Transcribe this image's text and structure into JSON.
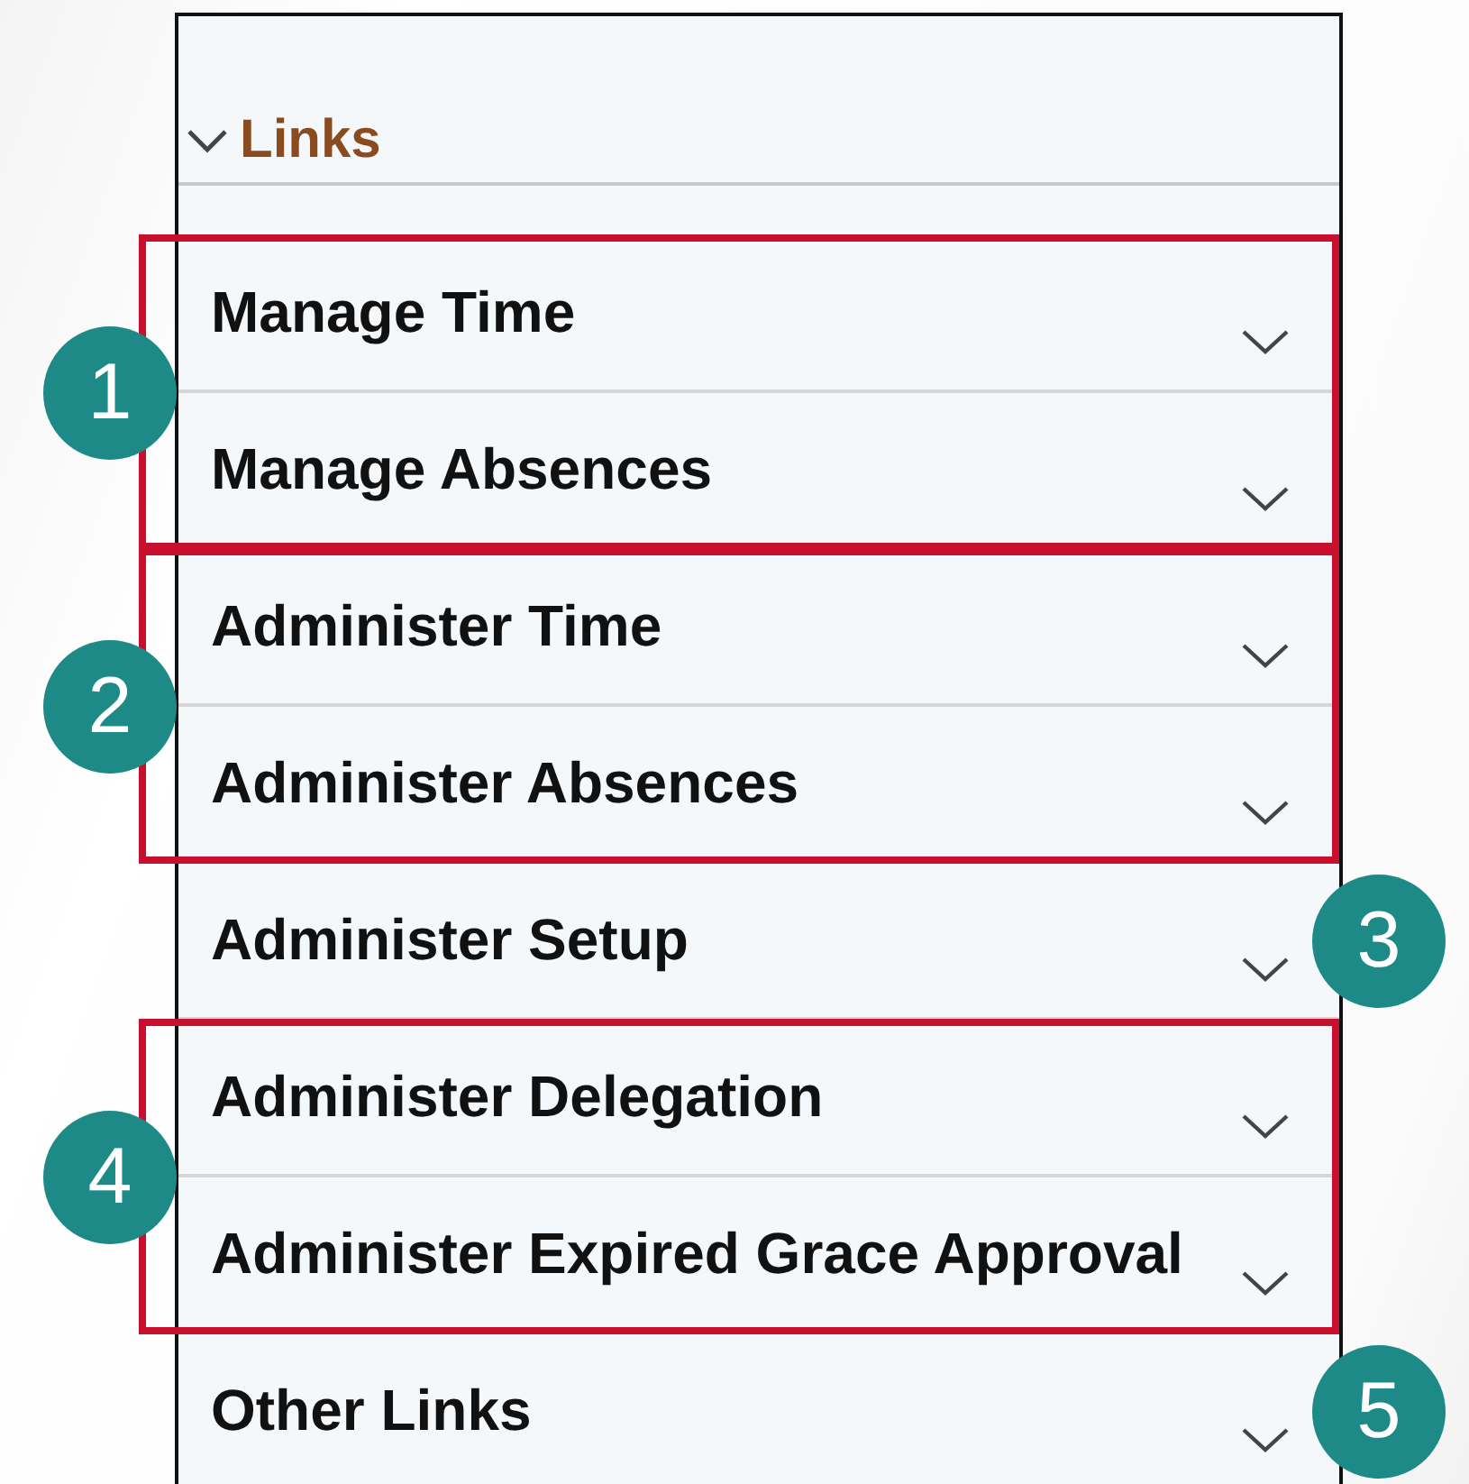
{
  "header": {
    "title": "Links",
    "expanded": true
  },
  "sections": [
    {
      "callout": "1",
      "boxed": true,
      "items": [
        {
          "label": "Manage Time",
          "expanded": false
        },
        {
          "label": "Manage Absences",
          "expanded": false
        }
      ]
    },
    {
      "callout": "2",
      "boxed": true,
      "items": [
        {
          "label": "Administer Time",
          "expanded": false
        },
        {
          "label": "Administer Absences",
          "expanded": false
        }
      ]
    },
    {
      "callout": "3",
      "boxed": false,
      "items": [
        {
          "label": "Administer Setup",
          "expanded": false
        }
      ]
    },
    {
      "callout": "4",
      "boxed": true,
      "items": [
        {
          "label": "Administer Delegation",
          "expanded": false
        },
        {
          "label": "Administer Expired Grace Approval",
          "expanded": false
        }
      ]
    },
    {
      "callout": "5",
      "boxed": false,
      "items": [
        {
          "label": "Other Links",
          "expanded": false
        }
      ]
    }
  ]
}
